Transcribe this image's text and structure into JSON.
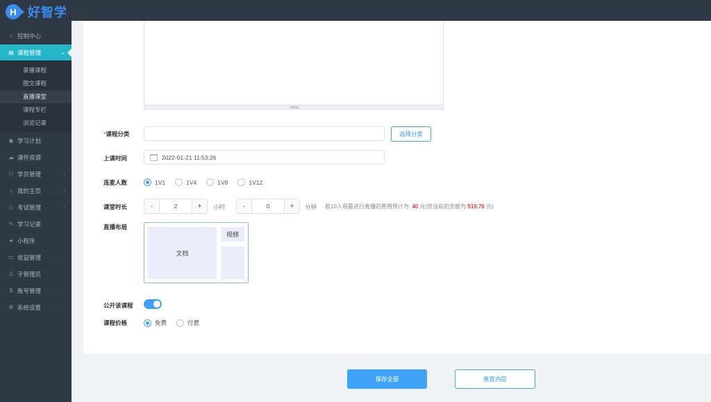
{
  "app": {
    "logo_letter": "H",
    "logo_text": "好智学"
  },
  "sidebar": {
    "items": [
      {
        "label": "控制中心",
        "icon": "home-icon"
      },
      {
        "label": "课程管理",
        "icon": "book-icon",
        "active": true
      },
      {
        "label": "学习计划",
        "icon": "eye-icon"
      },
      {
        "label": "课件资源",
        "icon": "cloud-icon"
      },
      {
        "label": "学员管理",
        "icon": "users-icon"
      },
      {
        "label": "我的主页",
        "icon": "cap-icon"
      },
      {
        "label": "考试管理",
        "icon": "tag-icon"
      },
      {
        "label": "学习记录",
        "icon": "edit-icon"
      },
      {
        "label": "小程序",
        "icon": "wechat-icon"
      },
      {
        "label": "收益管理",
        "icon": "card-icon"
      },
      {
        "label": "子管理员",
        "icon": "user-icon"
      },
      {
        "label": "账号管理",
        "icon": "dollar-icon"
      },
      {
        "label": "系统设置",
        "icon": "gear-icon"
      }
    ],
    "sub_items": [
      "录播课程",
      "图文课程",
      "直播课堂",
      "课程专栏",
      "浏览记录"
    ],
    "sub_current": "直播课堂"
  },
  "form": {
    "category": {
      "label": "课程分类",
      "required_mark": "*",
      "value": "",
      "button": "选择分类"
    },
    "time": {
      "label": "上课时间",
      "value": "2022-01-21 11:53:26"
    },
    "mic": {
      "label": "连麦人数",
      "options": [
        "1V1",
        "1V4",
        "1V8",
        "1V12"
      ],
      "selected": "1V1"
    },
    "duration": {
      "label": "课堂时长",
      "hours": "2",
      "hours_unit": "小时",
      "minutes": "0",
      "minutes_unit": "分钟",
      "minus": "-",
      "plus": "+",
      "hint_prefix": "若10人观看进行直播的费用预计为:",
      "cost": "40",
      "hint_mid": "元(您当前的余额为",
      "balance": "519.76",
      "hint_suffix": "元)"
    },
    "layout": {
      "label": "直播布局",
      "doc": "文档",
      "video": "视频"
    },
    "public": {
      "label": "公开该课程",
      "on": true
    },
    "price": {
      "label": "课程价格",
      "options": [
        "免费",
        "付费"
      ],
      "selected": "免费"
    }
  },
  "actions": {
    "save": "保存全部",
    "reset": "重置内容"
  }
}
